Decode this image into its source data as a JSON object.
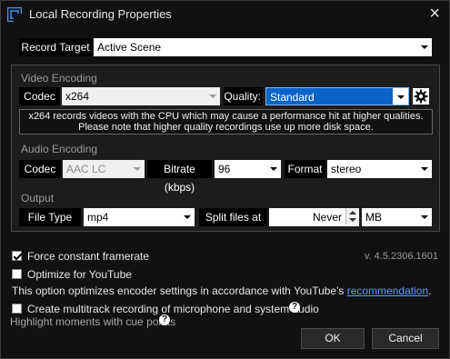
{
  "window": {
    "title": "Local Recording Properties"
  },
  "record_target": {
    "label": "Record Target",
    "value": "Active Scene"
  },
  "video": {
    "section_label": "Video Encoding",
    "codec_label": "Codec",
    "codec_value": "x264",
    "quality_label": "Quality:",
    "quality_value": "Standard",
    "note_line1": "x264 records videos with the CPU which may cause a performance hit at higher qualities.",
    "note_line2": "Please note that higher quality recordings use up more disk space."
  },
  "audio": {
    "section_label": "Audio Encoding",
    "codec_label": "Codec",
    "codec_value": "AAC LC",
    "bitrate_label": "Bitrate (kbps)",
    "bitrate_value": "96",
    "format_label": "Format",
    "format_value": "stereo"
  },
  "output": {
    "section_label": "Output",
    "file_type_label": "File Type",
    "file_type_value": "mp4",
    "split_label": "Split files at",
    "split_value": "Never",
    "split_unit": "MB"
  },
  "options": {
    "force_cfr": {
      "label": "Force constant framerate",
      "checked": true
    },
    "optimize_youtube": {
      "label": "Optimize for YouTube",
      "checked": false
    },
    "youtube_note_prefix": "This option optimizes encoder settings in accordance with YouTube's ",
    "youtube_note_link": "recommendation",
    "youtube_note_suffix": ".",
    "multitrack": {
      "label": "Create multitrack recording of microphone and system audio",
      "checked": false
    },
    "cue_points_label": "Highlight moments with cue points"
  },
  "version": "v. 4.5.2306.1601",
  "buttons": {
    "ok": "OK",
    "cancel": "Cancel"
  },
  "icons": {
    "app": "app-logo-icon",
    "close": "close-icon",
    "settings": "gear-icon",
    "help": "help-icon"
  }
}
